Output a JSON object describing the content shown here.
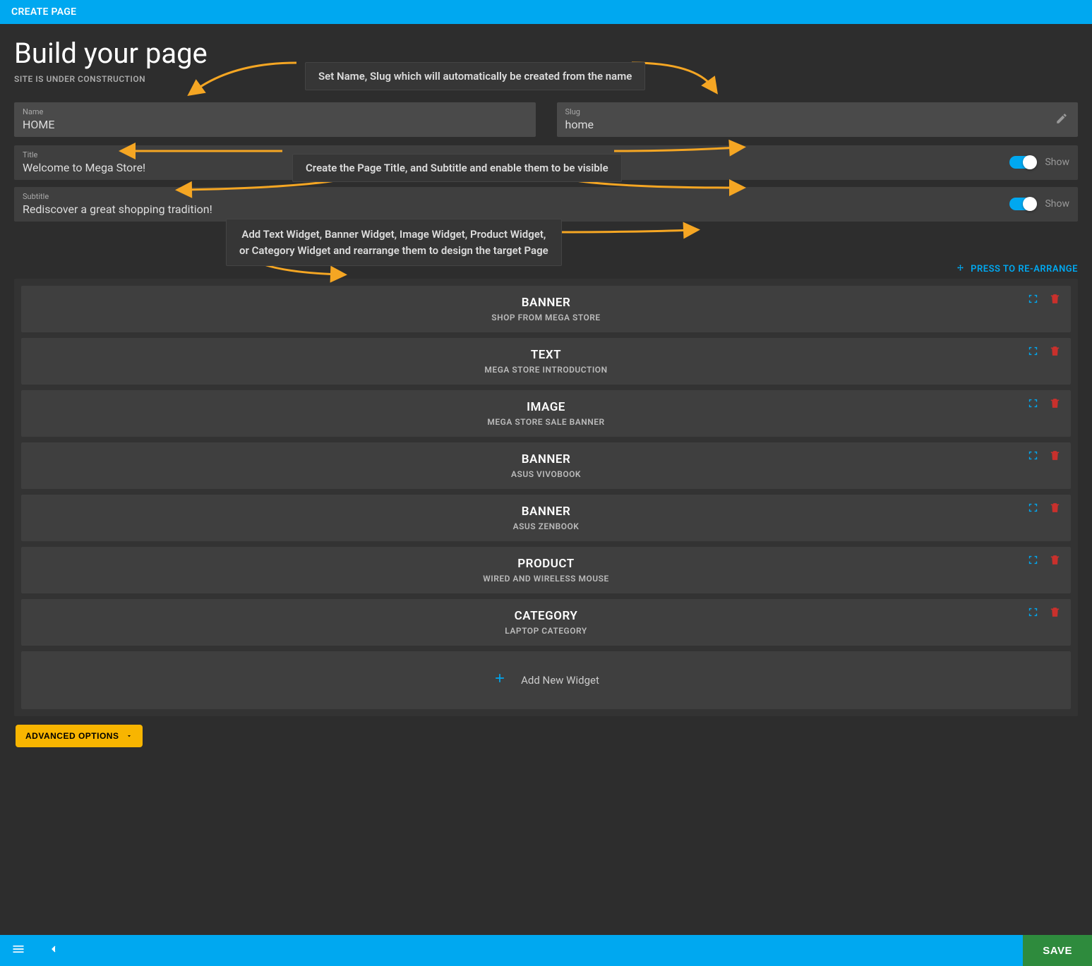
{
  "topbar": {
    "title": "CREATE PAGE"
  },
  "header": {
    "title": "Build your page",
    "status": "SITE IS UNDER CONSTRUCTION"
  },
  "callouts": {
    "name_slug": "Set Name, Slug which will automatically be created from the name",
    "title_sub": "Create the Page Title, and Subtitle and enable them to be visible",
    "widgets_l1": "Add Text Widget, Banner Widget, Image Widget, Product Widget,",
    "widgets_l2": "or Category Widget and rearrange them to design the target Page"
  },
  "fields": {
    "name": {
      "label": "Name",
      "value": "HOME"
    },
    "slug": {
      "label": "Slug",
      "value": "home"
    },
    "title": {
      "label": "Title",
      "value": "Welcome to Mega Store!",
      "toggle_label": "Show"
    },
    "subtitle": {
      "label": "Subtitle",
      "value": "Rediscover a great shopping tradition!",
      "toggle_label": "Show"
    }
  },
  "rearrange_label": "PRESS TO RE-ARRANGE",
  "widgets": [
    {
      "type": "BANNER",
      "name": "SHOP FROM MEGA STORE"
    },
    {
      "type": "TEXT",
      "name": "MEGA STORE INTRODUCTION"
    },
    {
      "type": "IMAGE",
      "name": "MEGA STORE SALE BANNER"
    },
    {
      "type": "BANNER",
      "name": "ASUS VIVOBOOK"
    },
    {
      "type": "BANNER",
      "name": "ASUS ZENBOOK"
    },
    {
      "type": "PRODUCT",
      "name": "WIRED AND WIRELESS MOUSE"
    },
    {
      "type": "CATEGORY",
      "name": "LAPTOP CATEGORY"
    }
  ],
  "add_widget_label": "Add New Widget",
  "advanced_label": "ADVANCED OPTIONS",
  "save_label": "SAVE"
}
